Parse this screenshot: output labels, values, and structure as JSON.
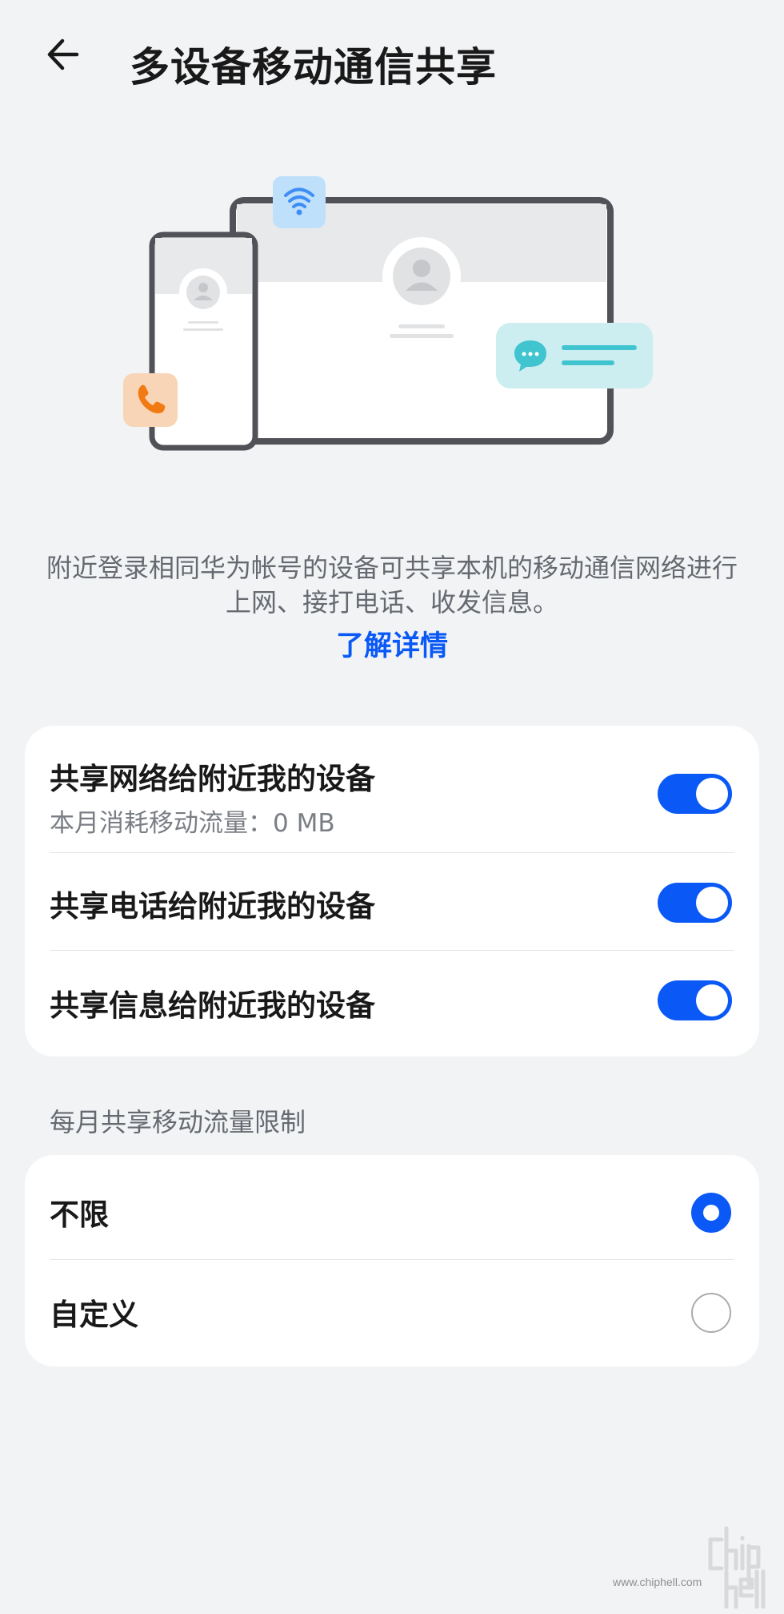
{
  "header": {
    "title": "多设备移动通信共享",
    "back_icon": "arrow-left-icon"
  },
  "illustration": {
    "icons": [
      "phone-device",
      "tablet-device",
      "wifi-icon",
      "phone-call-icon",
      "chat-bubble-icon",
      "user-avatar-icon"
    ],
    "colors": {
      "wifi_badge": "#bfe0fb",
      "call_badge": "#f8d5b6",
      "call_accent": "#f27a13",
      "message_card": "#cdeef0",
      "message_accent": "#40c4d0"
    }
  },
  "description": {
    "text": "附近登录相同华为帐号的设备可共享本机的移动通信网络进行上网、接打电话、收发信息。",
    "link_label": "了解详情"
  },
  "sharing": {
    "items": [
      {
        "title": "共享网络给附近我的设备",
        "subtitle": "本月消耗移动流量：0 MB",
        "enabled": true
      },
      {
        "title": "共享电话给附近我的设备",
        "enabled": true
      },
      {
        "title": "共享信息给附近我的设备",
        "enabled": true
      }
    ]
  },
  "limit": {
    "section_label": "每月共享移动流量限制",
    "options": [
      {
        "label": "不限",
        "selected": true
      },
      {
        "label": "自定义",
        "selected": false
      }
    ]
  },
  "watermark": {
    "logo_text": "chiphell",
    "url": "www.chiphell.com"
  },
  "colors": {
    "accent": "#0a59f7",
    "background": "#f1f3f5",
    "card": "#ffffff"
  }
}
